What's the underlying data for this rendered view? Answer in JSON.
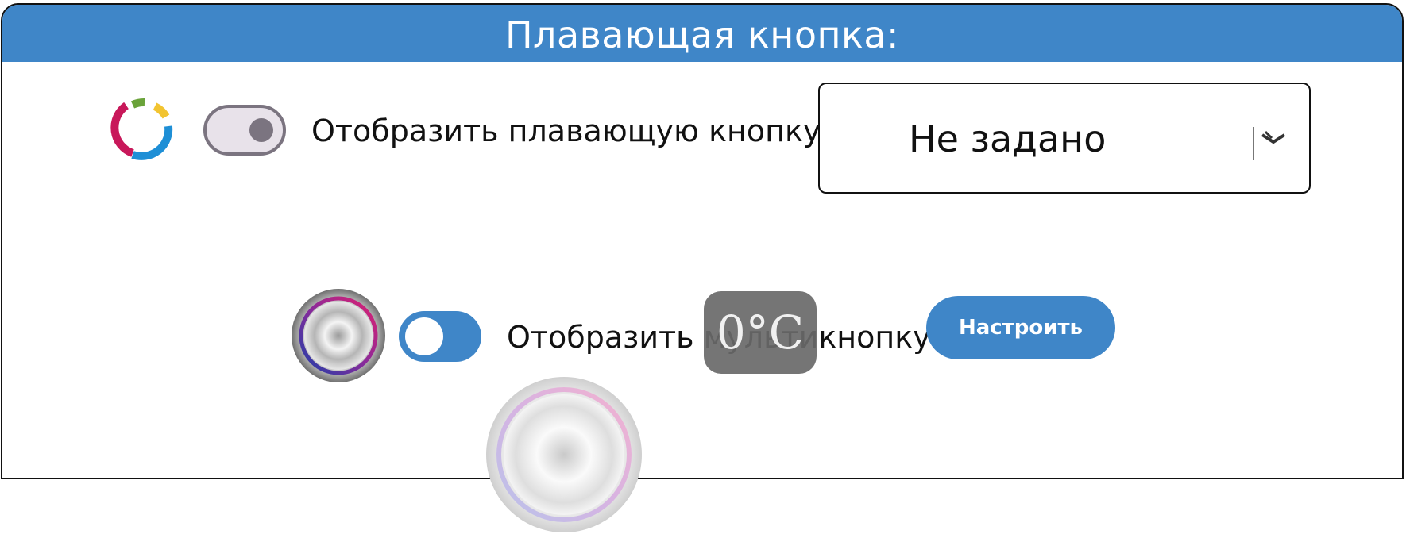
{
  "header": {
    "title": "Плавающая кнопка:"
  },
  "floating_button": {
    "label": "Отобразить плавающую кнопку",
    "toggle_state": "off",
    "dropdown_value": "Не задано"
  },
  "multibutton": {
    "label": "Отобразить мультикнопку",
    "toggle_state": "on",
    "configure_label": "Настроить"
  },
  "overlay": {
    "temperature": "0°C"
  },
  "colors": {
    "accent": "#3f86c8",
    "toggle_off_track": "#e8e2ea",
    "toggle_off_knob": "#7b7480",
    "overlay_bg": "#696969"
  },
  "icons": {
    "app_logo": "ring-logo-icon",
    "multibutton": "metal-dial-icon",
    "floating_preview": "metal-dial-icon",
    "dropdown": "chevron-down-icon"
  }
}
